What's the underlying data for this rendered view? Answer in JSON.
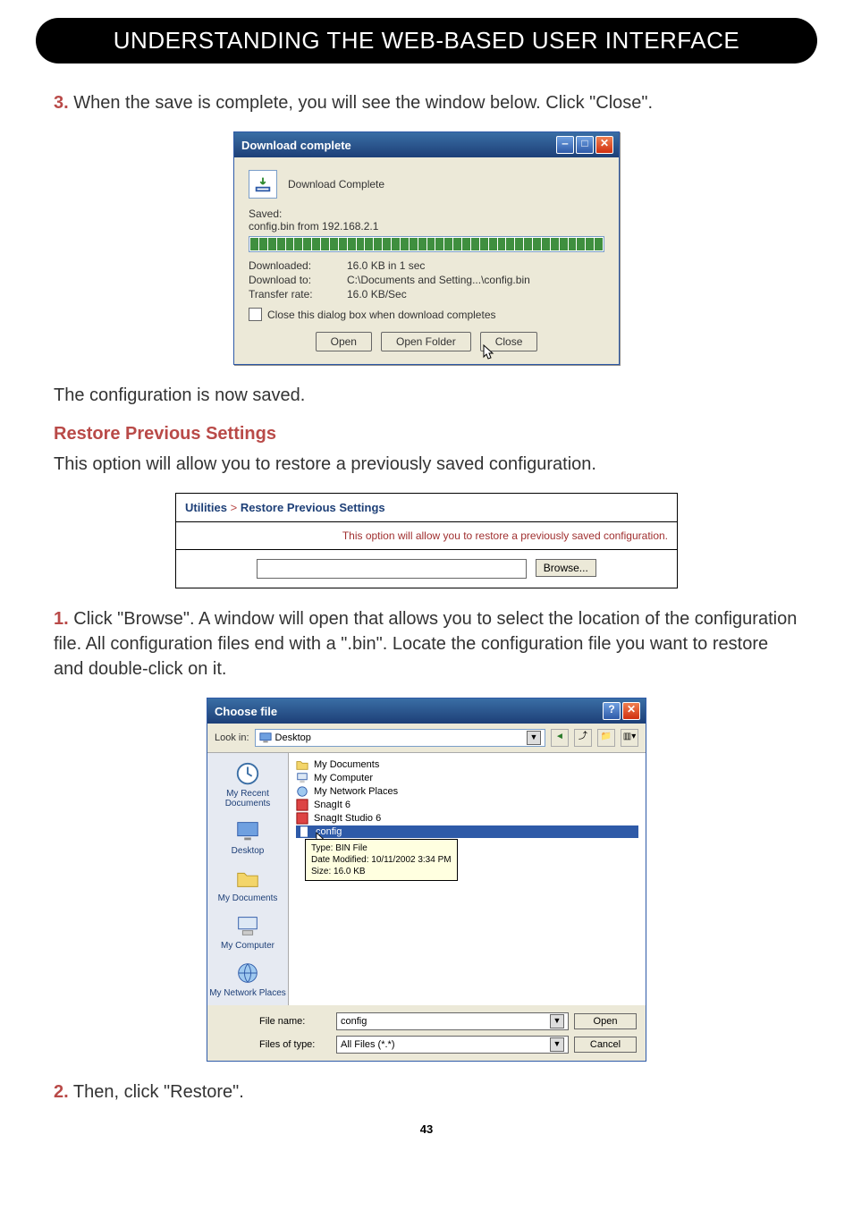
{
  "header": {
    "title": "UNDERSTANDING THE WEB-BASED USER INTERFACE"
  },
  "step3": {
    "num": "3.",
    "text": "When the save is complete, you will see the window below. Click \"Close\"."
  },
  "dl_dialog": {
    "title": "Download complete",
    "subtitle": "Download Complete",
    "saved_label": "Saved:",
    "saved_value": "config.bin from 192.168.2.1",
    "downloaded_label": "Downloaded:",
    "downloaded_value": "16.0 KB in 1 sec",
    "downloadto_label": "Download to:",
    "downloadto_value": "C:\\Documents and Setting...\\config.bin",
    "rate_label": "Transfer rate:",
    "rate_value": "16.0 KB/Sec",
    "checkbox_label": "Close this dialog box when download completes",
    "btn_open": "Open",
    "btn_openfolder": "Open Folder",
    "btn_close": "Close"
  },
  "config_saved_text": "The configuration is now saved.",
  "subhead_restore": "Restore Previous Settings",
  "restore_intro": "This option will allow you to restore a previously saved configuration.",
  "rps": {
    "title_prefix": "Utilities",
    "gt": ">",
    "title_suffix": "Restore Previous Settings",
    "desc": "This option will allow you to restore a previously saved configuration.",
    "browse": "Browse..."
  },
  "step1": {
    "num": "1.",
    "text": "Click \"Browse\". A window will open that allows you to select the location of the configuration file. All configuration files end with a \".bin\". Locate the configuration file you want to restore and double-click on it."
  },
  "cf": {
    "title": "Choose file",
    "lookin_label": "Look in:",
    "lookin_value": "Desktop",
    "places": {
      "recent": "My Recent Documents",
      "desktop": "Desktop",
      "mydocs": "My Documents",
      "mycomp": "My Computer",
      "mynet": "My Network Places"
    },
    "files": {
      "mydocuments": "My Documents",
      "mycomputer": "My Computer",
      "mynetworkplaces": "My Network Places",
      "snagit6": "SnagIt 6",
      "snagitstudio6": "SnagIt Studio 6",
      "config": "config"
    },
    "tooltip": {
      "l1": "Type: BIN File",
      "l2": "Date Modified: 10/11/2002 3:34 PM",
      "l3": "Size: 16.0 KB"
    },
    "filename_label": "File name:",
    "filename_value": "config",
    "filetype_label": "Files of type:",
    "filetype_value": "All Files (*.*)",
    "open": "Open",
    "cancel": "Cancel"
  },
  "step2": {
    "num": "2.",
    "text": "Then, click \"Restore\"."
  },
  "page_number": "43"
}
